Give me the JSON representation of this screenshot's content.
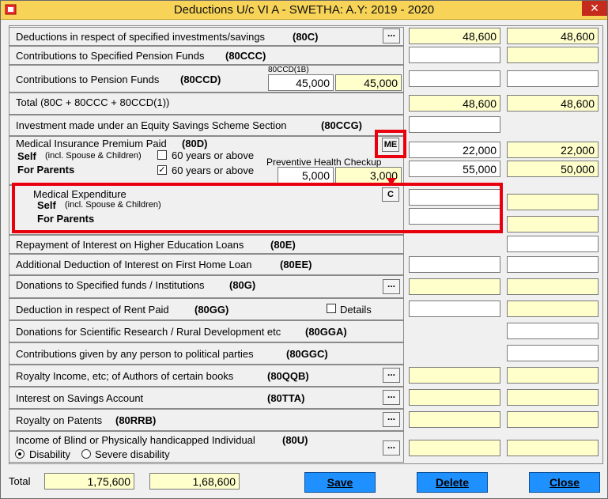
{
  "window": {
    "title": "Deductions U/c VI A - SWETHA: A.Y: 2019 - 2020",
    "close_glyph": "✕"
  },
  "rows": {
    "r80c": {
      "label": "Deductions in respect of specified investments/savings",
      "section": "(80C)",
      "more": "...",
      "col1": "48,600",
      "col2": "48,600"
    },
    "r80ccc": {
      "label": "Contributions to Specified Pension Funds",
      "section": "(80CCC)",
      "col1": "",
      "col2": ""
    },
    "r80ccd": {
      "label": "Contributions to Pension Funds",
      "section": "(80CCD)",
      "sub_label": "80CCD(1B)",
      "sub_value1": "45,000",
      "sub_value2": "45,000",
      "col1": "",
      "col2": ""
    },
    "total80": {
      "label": "Total (80C + 80CCC + 80CCD(1))",
      "col1": "48,600",
      "col2": "48,600"
    },
    "r80ccg": {
      "label": "Investment made under an Equity Savings Scheme Section",
      "section": "(80CCG)",
      "col1": ""
    },
    "r80d": {
      "label": "Medical Insurance Premium Paid",
      "section": "(80D)",
      "me_button": "ME",
      "self_label": "Self",
      "self_note": "(incl. Spouse & Children)",
      "self_senior": "60 years or above",
      "parents_label": "For Parents",
      "parents_senior": "60 years or above",
      "parents_checked": "✓",
      "phc_label": "Preventive Health Checkup",
      "phc_value1": "5,000",
      "phc_value2": "3,000",
      "self_col1": "22,000",
      "self_col2": "22,000",
      "parents_col1": "55,000",
      "parents_col2": "50,000"
    },
    "medexp": {
      "label": "Medical Expenditure",
      "c_button": "C",
      "self_label": "Self",
      "self_note": "(incl. Spouse & Children)",
      "parents_label": "For Parents",
      "self_col1": "",
      "parents_col1": "",
      "self_col2": "",
      "parents_col2": ""
    },
    "r80e": {
      "label": "Repayment of Interest on Higher Education Loans",
      "section": "(80E)",
      "col2": ""
    },
    "r80ee": {
      "label": "Additional Deduction of Interest on First Home Loan",
      "section": "(80EE)",
      "col1": "",
      "col2": ""
    },
    "r80g": {
      "label": "Donations to Specified funds / Institutions",
      "section": "(80G)",
      "more": "...",
      "col1": "",
      "col2": ""
    },
    "r80gg": {
      "label": "Deduction in respect of Rent Paid",
      "section": "(80GG)",
      "details_label": "Details",
      "col1": "",
      "col2": ""
    },
    "r80gga": {
      "label": "Donations for Scientific Research / Rural Development etc",
      "section": "(80GGA)",
      "col2": ""
    },
    "r80ggc": {
      "label": "Contributions given by any person to political parties",
      "section": "(80GGC)",
      "col2": ""
    },
    "r80qqb": {
      "label": "Royalty Income, etc; of Authors of certain books",
      "section": "(80QQB)",
      "more": "...",
      "col1": "",
      "col2": ""
    },
    "r80tta": {
      "label": "Interest on Savings Account",
      "section": "(80TTA)",
      "more": "...",
      "col1": "",
      "col2": ""
    },
    "r80rrb": {
      "label": "Royalty on Patents",
      "section": "(80RRB)",
      "more": "...",
      "col1": "",
      "col2": ""
    },
    "r80u": {
      "label": "Income of Blind or Physically handicapped Individual",
      "section": "(80U)",
      "opt1": "Disability",
      "opt2": "Severe disability",
      "more": "...",
      "col1": "",
      "col2": ""
    }
  },
  "footer": {
    "total_label": "Total",
    "total1": "1,75,600",
    "total2": "1,68,600",
    "save": "Save",
    "delete": "Delete",
    "close": "Close"
  },
  "colors": {
    "titlebar": "#f7d358",
    "field_yellow": "#ffffcc",
    "highlight_red": "#e8000f",
    "button_blue": "#1e90ff"
  }
}
